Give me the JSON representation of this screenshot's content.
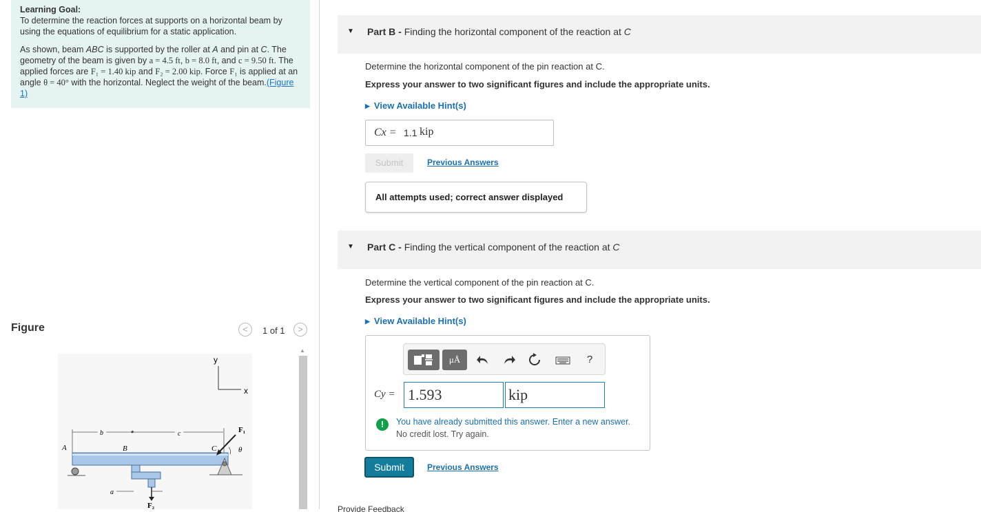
{
  "learning_goal": {
    "heading": "Learning Goal:",
    "text": "To determine the reaction forces at supports on a horizontal beam by using the equations of equilibrium for a static application.",
    "desc_1": "As shown, beam ",
    "beam_name": "ABC",
    "desc_2": " is supported by the roller at ",
    "point_a": "A",
    "desc_3": " and pin at ",
    "point_c": "C",
    "desc_4": ". The geometry of the beam is given by ",
    "eq_a": "a = 4.5 ft",
    "sep_1": ", ",
    "eq_b": "b = 8.0 ft",
    "sep_2": ", and ",
    "eq_c": "c = 9.50 ft",
    "desc_5": ". The applied forces are ",
    "eq_f1": "F₁ = 1.40 kip",
    "desc_6": " and ",
    "eq_f2": "F₂ = 2.00 kip",
    "desc_7": ". Force ",
    "f1_name": "F₁",
    "desc_8": " is applied at an angle ",
    "eq_theta": "θ = 40°",
    "desc_9": " with the horizontal. Neglect the weight of the beam.",
    "figure_link": "(Figure 1)"
  },
  "figure": {
    "title": "Figure",
    "counter": "1 of 1",
    "prev_glyph": "<",
    "next_glyph": ">",
    "labels": {
      "y": "y",
      "x": "x",
      "b": "b",
      "c": "c",
      "a": "a",
      "A": "A",
      "B": "B",
      "C": "C",
      "F1": "F₁",
      "F2": "F₂",
      "theta": "θ"
    }
  },
  "partB": {
    "title_bold": "Part B - ",
    "title_rest": "Finding the horizontal component of the reaction at ",
    "title_point": "C",
    "question": "Determine the horizontal component of the pin reaction at C.",
    "instruction": "Express your answer to two significant figures and include the appropriate units.",
    "hint": "View Available Hint(s)",
    "answer_label": "Cx =",
    "answer_value": "1.1",
    "answer_unit": "kip",
    "submit": "Submit",
    "previous_answers": "Previous Answers",
    "status": "All attempts used; correct answer displayed"
  },
  "partC": {
    "title_bold": "Part C - ",
    "title_rest": "Finding the vertical component of the reaction at ",
    "title_point": "C",
    "question": "Determine the vertical component of the pin reaction at C.",
    "instruction": "Express your answer to two significant figures and include the appropriate units.",
    "hint": "View Available Hint(s)",
    "toolbar": {
      "units_label": "μÅ",
      "help_label": "?",
      "icons": [
        "templates-icon",
        "units-icon",
        "undo-icon",
        "redo-icon",
        "reset-icon",
        "keyboard-icon",
        "help-icon"
      ]
    },
    "answer_label": "Cy =",
    "answer_value": "1.593",
    "answer_unit": "kip",
    "warning_icon_glyph": "!",
    "warning_line1": "You have already submitted this answer. Enter a new answer.",
    "warning_line2": "No credit lost. Try again.",
    "submit": "Submit",
    "previous_answers": "Previous Answers"
  },
  "footer": {
    "provide_feedback": "Provide Feedback"
  },
  "colors": {
    "goal_bg": "#e5f3f3",
    "link": "#1a6fb5",
    "submit_active": "#137d9b",
    "submit_disabled": "#eeeeee",
    "warning_icon": "#12a04c",
    "part_header_bg": "#f2f2f2"
  }
}
